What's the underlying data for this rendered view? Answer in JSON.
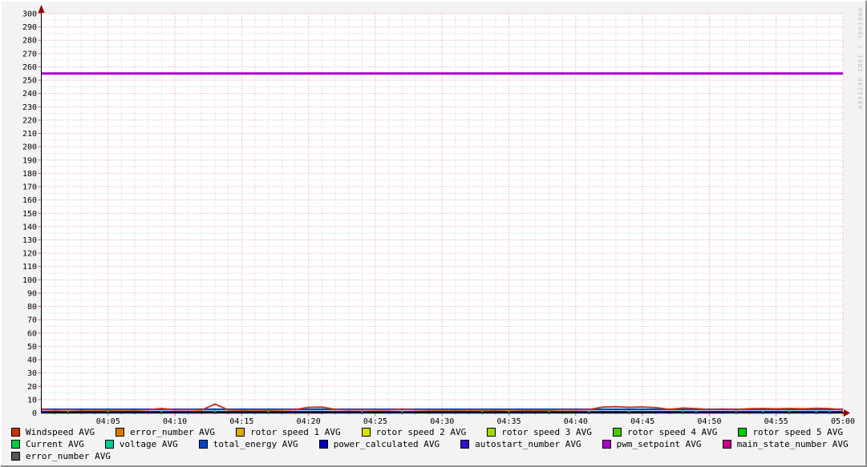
{
  "watermark": "RRDTOOL / TOBI OETIKER",
  "colors": {
    "background": "#f3f3f3",
    "plot_background": "#ffffff",
    "grid_minor": "#cfcfcf",
    "grid_major": "#ec9a9a",
    "tick": "#d06060",
    "axis": "#000000",
    "arrow": "#990000",
    "text": "#000000",
    "watermark": "#bdbdbd"
  },
  "chart_data": {
    "type": "line",
    "title": "",
    "xlabel": "",
    "ylabel": "",
    "time_window": "04:00 - 05:00",
    "x_axis": {
      "start_minute": 0,
      "end_minute": 60,
      "minor_tick_minutes": 1,
      "major_tick_minutes": 5,
      "tick_labels": [
        "04:05",
        "04:10",
        "04:15",
        "04:20",
        "04:25",
        "04:30",
        "04:35",
        "04:40",
        "04:45",
        "04:50",
        "04:55",
        "05:00"
      ]
    },
    "y_axis": {
      "min": 0,
      "max": 300,
      "label_step": 10,
      "minor_step": 5
    },
    "grid": true,
    "legend_position": "bottom",
    "series": [
      {
        "name": "pwm_setpoint AVG",
        "type": "hline",
        "color": "#aa00cc",
        "width": 3,
        "value": 255
      },
      {
        "name": "total_energy AVG",
        "type": "hline",
        "color": "#0a42cc",
        "width": 2.4,
        "value": 2.7
      },
      {
        "name": "power_calculated AVG",
        "type": "hline",
        "color": "#000099",
        "width": 2.4,
        "value": 0.7
      },
      {
        "name": "voltage AVG",
        "type": "dots",
        "color": "#00cc99",
        "value": 1.3,
        "x_minutes": [
          5,
          13,
          24,
          33,
          38,
          44,
          48,
          52,
          56,
          59
        ]
      },
      {
        "name": "Current AVG",
        "type": "dots",
        "color": "#00cc44",
        "value": 0.9,
        "x_minutes": [
          2,
          9,
          17,
          27,
          35,
          41,
          49,
          54,
          58
        ]
      },
      {
        "name": "Windspeed AVG",
        "type": "line",
        "color": "#c5341a",
        "width": 1.8,
        "start_minute": 0,
        "step_minutes": 1,
        "values": [
          2.6,
          2.2,
          2.4,
          2.1,
          2.3,
          2.1,
          2.3,
          2.1,
          2.4,
          3.4,
          2.3,
          2.5,
          2.2,
          6.6,
          2.3,
          2.1,
          2.3,
          2.1,
          2.3,
          2.5,
          4.2,
          4.4,
          2.7,
          2.3,
          2.5,
          2.3,
          2.3,
          2.9,
          2.4,
          2.2,
          2.3,
          2.1,
          2.3,
          2.2,
          2.1,
          2.3,
          2.1,
          2.2,
          2.1,
          2.4,
          2.3,
          2.6,
          4.4,
          4.7,
          4.2,
          4.5,
          4.0,
          2.7,
          3.7,
          3.3,
          2.5,
          3.0,
          2.5,
          3.2,
          3.4,
          3.1,
          3.4,
          3.1,
          3.5,
          3.3,
          2.3
        ]
      }
    ]
  },
  "legend": {
    "rows": [
      [
        {
          "label": "Windspeed AVG",
          "color": "#cc3300"
        },
        {
          "label": "error_number AVG",
          "color": "#dd7700"
        },
        {
          "label": "rotor speed 1 AVG",
          "color": "#ddaa00"
        },
        {
          "label": "rotor speed 2 AVG",
          "color": "#dddd00"
        },
        {
          "label": "rotor speed 3 AVG",
          "color": "#99dd00"
        },
        {
          "label": "rotor speed 4 AVG",
          "color": "#44cc00"
        },
        {
          "label": "rotor speed 5 AVG",
          "color": "#00cc00"
        }
      ],
      [
        {
          "label": "Current AVG",
          "color": "#00cc44"
        },
        {
          "label": "voltage AVG",
          "color": "#00cc99"
        },
        {
          "label": "total_energy AVG",
          "color": "#0044cc"
        },
        {
          "label": "power_calculated AVG",
          "color": "#0000bb"
        },
        {
          "label": "autostart_number AVG",
          "color": "#3311cc"
        },
        {
          "label": "pwm_setpoint AVG",
          "color": "#aa00cc"
        },
        {
          "label": "main_state_number AVG",
          "color": "#cc0088"
        }
      ],
      [
        {
          "label": "error_number AVG",
          "color": "#555555"
        }
      ]
    ]
  }
}
